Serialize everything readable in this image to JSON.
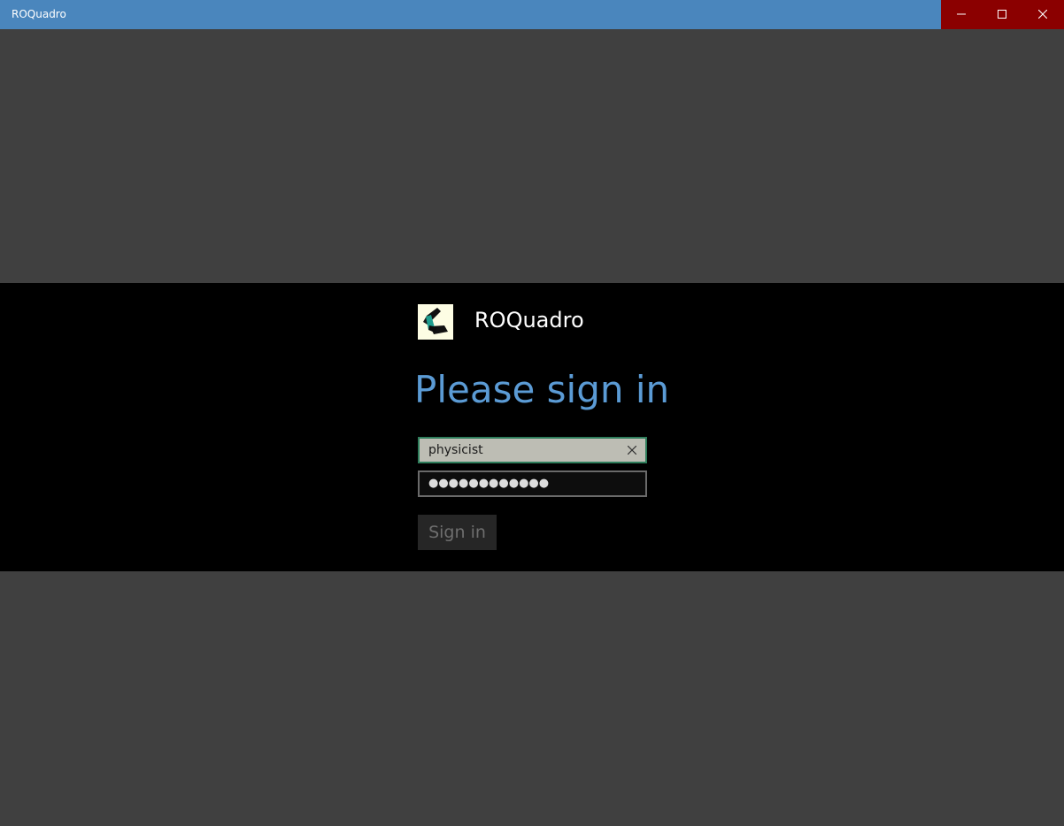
{
  "window": {
    "title": "ROQuadro",
    "controls": {
      "minimize_icon": "minimize-icon",
      "maximize_icon": "maximize-icon",
      "close_icon": "close-icon"
    },
    "colors": {
      "titlebar": "#4a86bd",
      "controls_bg": "#8b0000",
      "background": "#404040"
    }
  },
  "login": {
    "app_name": "ROQuadro",
    "logo_icon": "roquadro-logo-icon",
    "heading": "Please sign in",
    "username": {
      "value": "physicist",
      "clear_icon": "clear-icon"
    },
    "password": {
      "masked_value": "●●●●●●●●●●●●"
    },
    "signin_label": "Sign in",
    "colors": {
      "heading": "#5b9bd5",
      "band": "#000000"
    }
  }
}
